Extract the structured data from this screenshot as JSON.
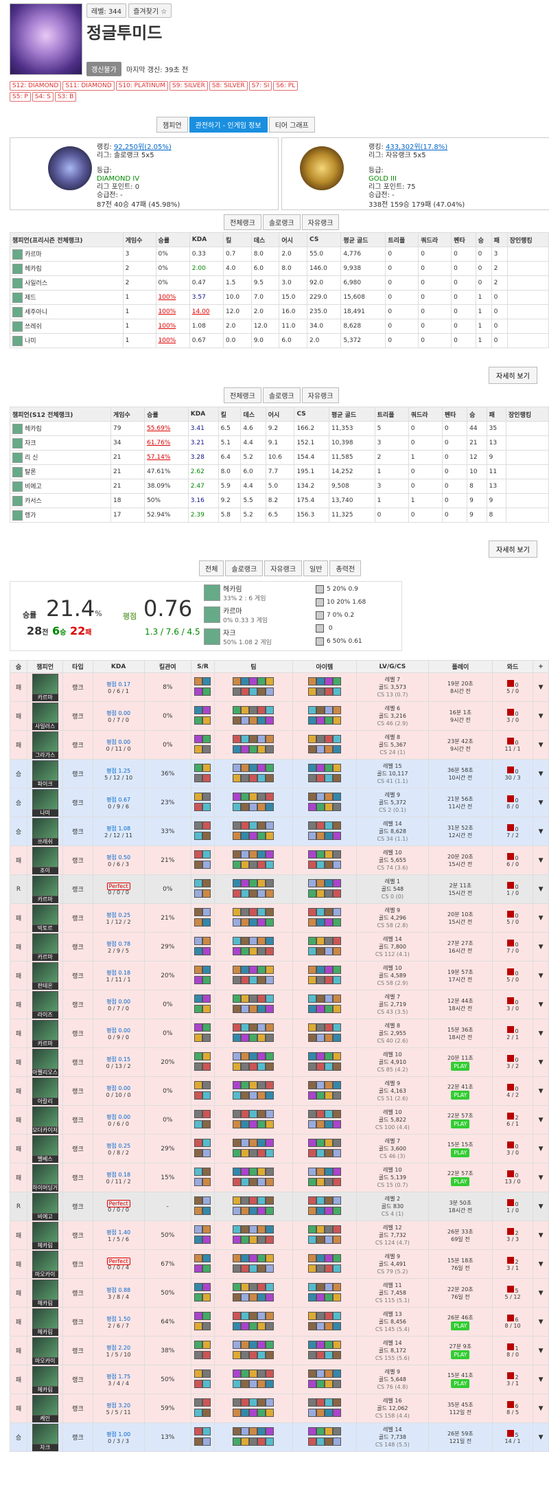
{
  "profile": {
    "level": "레벨: 344",
    "favorite": "즐겨찾기 ☆",
    "name": "정글투미드",
    "refresh": "갱신불가",
    "last_update": "마지막 갱신: 39초 전",
    "seasons": [
      "S12: DIAMOND",
      "S11: DIAMOND",
      "S10: PLATINUM",
      "S9: SILVER",
      "S8: SILVER",
      "S7: SI",
      "S6: PL",
      "S5: P",
      "S4: S",
      "S3: B"
    ]
  },
  "tabs": [
    "챔피언",
    "관전하기 - 인게임 정보",
    "티어 그래프"
  ],
  "solo": {
    "rank_label": "랭킹:",
    "rank_val": "92,250위",
    "rank_pct": "(2.05%)",
    "league": "리그: 솔로랭크 5x5",
    "tier_label": "등급:",
    "tier": "DIAMOND IV",
    "lp": "리그 포인트: 0",
    "promo": "승급전: -",
    "record": "87전 40승 47패 (45.98%)"
  },
  "flex": {
    "rank_label": "랭킹:",
    "rank_val": "433,302위",
    "rank_pct": "(17.8%)",
    "league": "리그: 자유랭크 5x5",
    "tier_label": "등급:",
    "tier": "GOLD III",
    "lp": "리그 포인트: 75",
    "promo": "승급전: -",
    "record": "338전 159승 179패 (47.04%)"
  },
  "queue_tabs": [
    "전체랭크",
    "솔로랭크",
    "자유랭크"
  ],
  "table1": {
    "headers": [
      "챔피언(프리시즌 전체랭크)",
      "게임수",
      "승률",
      "KDA",
      "킬",
      "데스",
      "어시",
      "CS",
      "평균 골드",
      "트리플",
      "쿼드라",
      "펜타",
      "승",
      "패",
      "장인랭킹"
    ],
    "rows": [
      [
        "카르마",
        "3",
        "0%",
        "0.33",
        "0.7",
        "8.0",
        "2.0",
        "55.0",
        "4,776",
        "0",
        "0",
        "0",
        "0",
        "3",
        ""
      ],
      [
        "헤카림",
        "2",
        "0%",
        "2.00",
        "4.0",
        "6.0",
        "8.0",
        "146.0",
        "9,938",
        "0",
        "0",
        "0",
        "0",
        "2",
        ""
      ],
      [
        "사일러스",
        "2",
        "0%",
        "0.47",
        "1.5",
        "9.5",
        "3.0",
        "92.0",
        "6,980",
        "0",
        "0",
        "0",
        "0",
        "2",
        ""
      ],
      [
        "제드",
        "1",
        "100%",
        "3.57",
        "10.0",
        "7.0",
        "15.0",
        "229.0",
        "15,608",
        "0",
        "0",
        "0",
        "1",
        "0",
        ""
      ],
      [
        "세주아니",
        "1",
        "100%",
        "14.00",
        "12.0",
        "2.0",
        "16.0",
        "235.0",
        "18,491",
        "0",
        "0",
        "0",
        "1",
        "0",
        ""
      ],
      [
        "쓰레쉬",
        "1",
        "100%",
        "1.08",
        "2.0",
        "12.0",
        "11.0",
        "34.0",
        "8,628",
        "0",
        "0",
        "0",
        "1",
        "0",
        ""
      ],
      [
        "나미",
        "1",
        "100%",
        "0.67",
        "0.0",
        "9.0",
        "6.0",
        "2.0",
        "5,372",
        "0",
        "0",
        "0",
        "1",
        "0",
        ""
      ]
    ]
  },
  "more": "자세히 보기",
  "table2": {
    "headers": [
      "챔피언(S12 전체랭크)",
      "게임수",
      "승률",
      "KDA",
      "킬",
      "데스",
      "어시",
      "CS",
      "평균 골드",
      "트리플",
      "쿼드라",
      "펜타",
      "승",
      "패",
      "장인랭킹"
    ],
    "rows": [
      [
        "헤카림",
        "79",
        "55.69%",
        "3.41",
        "6.5",
        "4.6",
        "9.2",
        "166.2",
        "11,353",
        "5",
        "0",
        "0",
        "44",
        "35",
        ""
      ],
      [
        "자크",
        "34",
        "61.76%",
        "3.21",
        "5.1",
        "4.4",
        "9.1",
        "152.1",
        "10,398",
        "3",
        "0",
        "0",
        "21",
        "13",
        ""
      ],
      [
        "리 신",
        "21",
        "57.14%",
        "3.28",
        "6.4",
        "5.2",
        "10.6",
        "154.4",
        "11,585",
        "2",
        "1",
        "0",
        "12",
        "9",
        ""
      ],
      [
        "탈론",
        "21",
        "47.61%",
        "2.62",
        "8.0",
        "6.0",
        "7.7",
        "195.1",
        "14,252",
        "1",
        "0",
        "0",
        "10",
        "11",
        ""
      ],
      [
        "비에고",
        "21",
        "38.09%",
        "2.47",
        "5.9",
        "4.4",
        "5.0",
        "134.2",
        "9,508",
        "3",
        "0",
        "0",
        "8",
        "13",
        ""
      ],
      [
        "카서스",
        "18",
        "50%",
        "3.16",
        "9.2",
        "5.5",
        "8.2",
        "175.4",
        "13,740",
        "1",
        "1",
        "0",
        "9",
        "9",
        ""
      ],
      [
        "렝가",
        "17",
        "52.94%",
        "2.39",
        "5.8",
        "5.2",
        "6.5",
        "156.3",
        "11,325",
        "0",
        "0",
        "0",
        "9",
        "8",
        ""
      ]
    ]
  },
  "filter_tabs": [
    "전체",
    "솔로랭크",
    "자유랭크",
    "일반",
    "총력전"
  ],
  "summary": {
    "wr_label": "승률",
    "wr": "21.4",
    "wr_unit": "%",
    "games": "28",
    "games_u": "전",
    "wins": "6",
    "wins_u": "승",
    "losses": "22",
    "losses_u": "패",
    "kda_label": "평점",
    "kda": "0.76",
    "kda_detail": "1.3 / 7.6 / 4.5",
    "top": [
      {
        "name": "헤카림",
        "line": "33%   2 : 6 게임"
      },
      {
        "name": "카르마",
        "line": "0%   0.33   3 게임"
      },
      {
        "name": "자크",
        "line": "50%   1.08   2 게임"
      }
    ],
    "positions": [
      {
        "a": "5",
        "b": "20%",
        "c": "0.9"
      },
      {
        "a": "10",
        "b": "20%",
        "c": "1.68"
      },
      {
        "a": "7",
        "b": "0%",
        "c": "0.2"
      },
      {
        "a": "",
        "b": "",
        "c": "0"
      },
      {
        "a": "6",
        "b": "50%",
        "c": "0.61"
      }
    ]
  },
  "match_headers": [
    "승",
    "챔피언",
    "타입",
    "KDA",
    "킬관여",
    "S/R",
    "팀",
    "아이템",
    "LV/G/CS",
    "플레이",
    "와드",
    "+"
  ],
  "matches": [
    {
      "r": "패",
      "c": "카르마",
      "t": "랭크",
      "k1": "평점 0.17",
      "k2": "0 / 6 / 1",
      "p": "8%",
      "lv": "레벨 7",
      "g": "골드 3,573",
      "cs": "CS 13 (0.7)",
      "pl1": "19분 20초",
      "pl2": "8시간 전",
      "w": "0",
      "w2": "5 / 0",
      "cls": "lose"
    },
    {
      "r": "패",
      "c": "사일러스",
      "t": "랭크",
      "k1": "평점 0.00",
      "k2": "0 / 7 / 0",
      "p": "0%",
      "lv": "레벨 6",
      "g": "골드 3,216",
      "cs": "CS 46 (2.9)",
      "pl1": "16분 1초",
      "pl2": "9시간 전",
      "w": "0",
      "w2": "3 / 0",
      "cls": "lose"
    },
    {
      "r": "패",
      "c": "그라가스",
      "t": "랭크",
      "k1": "평점 0.00",
      "k2": "0 / 11 / 0",
      "p": "0%",
      "lv": "레벨 8",
      "g": "골드 5,367",
      "cs": "CS 24 (1)",
      "pl1": "23분 42초",
      "pl2": "9시간 전",
      "w": "0",
      "w2": "11 / 1",
      "cls": "lose"
    },
    {
      "r": "승",
      "c": "파이크",
      "t": "랭크",
      "k1": "평점 1.25",
      "k2": "5 / 12 / 10",
      "p": "36%",
      "lv": "레벨 15",
      "g": "골드 10,117",
      "cs": "CS 41 (1.1)",
      "pl1": "36분 58초",
      "pl2": "10시간 전",
      "w": "0",
      "w2": "30 / 3",
      "cls": "win"
    },
    {
      "r": "승",
      "c": "나미",
      "t": "랭크",
      "k1": "평점 0.67",
      "k2": "0 / 9 / 6",
      "p": "23%",
      "lv": "레벨 9",
      "g": "골드 5,372",
      "cs": "CS 2 (0.1)",
      "pl1": "21분 56초",
      "pl2": "11시간 전",
      "w": "0",
      "w2": "8 / 0",
      "cls": "win"
    },
    {
      "r": "승",
      "c": "쓰레쉬",
      "t": "랭크",
      "k1": "평점 1.08",
      "k2": "2 / 12 / 11",
      "p": "33%",
      "lv": "레벨 14",
      "g": "골드 8,628",
      "cs": "CS 34 (1.1)",
      "pl1": "31분 52초",
      "pl2": "12시간 전",
      "w": "0",
      "w2": "7 / 2",
      "cls": "win"
    },
    {
      "r": "패",
      "c": "조이",
      "t": "랭크",
      "k1": "평점 0.50",
      "k2": "0 / 6 / 3",
      "p": "21%",
      "lv": "레벨 10",
      "g": "골드 5,655",
      "cs": "CS 74 (3.6)",
      "pl1": "20분 20초",
      "pl2": "15시간 전",
      "w": "0",
      "w2": "6 / 0",
      "cls": "lose"
    },
    {
      "r": "R",
      "c": "카르마",
      "t": "랭크",
      "k1": "Perfect",
      "k2": "0 / 0 / 0",
      "p": "0%",
      "lv": "레벨 1",
      "g": "골드 548",
      "cs": "CS 0 (0)",
      "pl1": "2분 11초",
      "pl2": "15시간 전",
      "w": "0",
      "w2": "1 / 0",
      "cls": "remake"
    },
    {
      "r": "패",
      "c": "빅토르",
      "t": "랭크",
      "k1": "평점 0.25",
      "k2": "1 / 12 / 2",
      "p": "21%",
      "lv": "레벨 9",
      "g": "골드 4,296",
      "cs": "CS 58 (2.8)",
      "pl1": "20분 10초",
      "pl2": "15시간 전",
      "w": "0",
      "w2": "5 / 0",
      "cls": "lose"
    },
    {
      "r": "패",
      "c": "카르마",
      "t": "랭크",
      "k1": "평점 0.78",
      "k2": "2 / 9 / 5",
      "p": "29%",
      "lv": "레벨 14",
      "g": "골드 7,800",
      "cs": "CS 112 (4.1)",
      "pl1": "27분 27초",
      "pl2": "16시간 전",
      "w": "0",
      "w2": "7 / 0",
      "cls": "lose"
    },
    {
      "r": "패",
      "c": "판테온",
      "t": "랭크",
      "k1": "평점 0.18",
      "k2": "1 / 11 / 1",
      "p": "20%",
      "lv": "레벨 10",
      "g": "골드 4,589",
      "cs": "CS 58 (2.9)",
      "pl1": "19분 57초",
      "pl2": "17시간 전",
      "w": "0",
      "w2": "5 / 0",
      "cls": "lose"
    },
    {
      "r": "패",
      "c": "라이즈",
      "t": "랭크",
      "k1": "평점 0.00",
      "k2": "0 / 7 / 0",
      "p": "0%",
      "lv": "레벨 7",
      "g": "골드 2,719",
      "cs": "CS 43 (3.5)",
      "pl1": "12분 44초",
      "pl2": "18시간 전",
      "w": "0",
      "w2": "3 / 0",
      "cls": "lose"
    },
    {
      "r": "패",
      "c": "카르마",
      "t": "랭크",
      "k1": "평점 0.00",
      "k2": "0 / 9 / 0",
      "p": "0%",
      "lv": "레벨 8",
      "g": "골드 2,955",
      "cs": "CS 40 (2.6)",
      "pl1": "15분 36초",
      "pl2": "18시간 전",
      "w": "0",
      "w2": "2 / 1",
      "cls": "lose"
    },
    {
      "r": "패",
      "c": "아펠리오스",
      "t": "랭크",
      "k1": "평점 0.15",
      "k2": "0 / 13 / 2",
      "p": "20%",
      "lv": "레벨 10",
      "g": "골드 4,910",
      "cs": "CS 85 (4.2)",
      "pl1": "20분 11초",
      "pl2": "PLAY",
      "w": "0",
      "w2": "3 / 2",
      "cls": "lose"
    },
    {
      "r": "패",
      "c": "아칼리",
      "t": "랭크",
      "k1": "평점 0.00",
      "k2": "0 / 10 / 0",
      "p": "0%",
      "lv": "레벨 9",
      "g": "골드 4,163",
      "cs": "CS 51 (2.6)",
      "pl1": "22분 41초",
      "pl2": "PLAY",
      "w": "0",
      "w2": "4 / 2",
      "cls": "lose"
    },
    {
      "r": "패",
      "c": "모더카이저",
      "t": "랭크",
      "k1": "평점 0.00",
      "k2": "0 / 6 / 0",
      "p": "0%",
      "lv": "레벨 10",
      "g": "골드 5,822",
      "cs": "CS 100 (4.4)",
      "pl1": "22분 57초",
      "pl2": "PLAY",
      "w": "2",
      "w2": "6 / 1",
      "cls": "lose"
    },
    {
      "r": "패",
      "c": "벨베스",
      "t": "랭크",
      "k1": "평점 0.25",
      "k2": "0 / 8 / 2",
      "p": "29%",
      "lv": "레벨 7",
      "g": "골드 3,600",
      "cs": "CS 46 (3)",
      "pl1": "15분 15초",
      "pl2": "PLAY",
      "w": "0",
      "w2": "3 / 0",
      "cls": "lose"
    },
    {
      "r": "패",
      "c": "하이머딩거",
      "t": "랭크",
      "k1": "평점 0.18",
      "k2": "0 / 11 / 2",
      "p": "15%",
      "lv": "레벨 10",
      "g": "골드 5,139",
      "cs": "CS 15 (0.7)",
      "pl1": "22분 57초",
      "pl2": "PLAY",
      "w": "0",
      "w2": "13 / 0",
      "cls": "lose"
    },
    {
      "r": "R",
      "c": "비에고",
      "t": "랭크",
      "k1": "Perfect",
      "k2": "0 / 0 / 0",
      "p": "-",
      "lv": "레벨 2",
      "g": "골드 830",
      "cs": "CS 4 (1)",
      "pl1": "3분 50초",
      "pl2": "18시간 전",
      "w": "0",
      "w2": "1 / 0",
      "cls": "remake"
    },
    {
      "r": "패",
      "c": "헤카림",
      "t": "랭크",
      "k1": "평점 1.40",
      "k2": "1 / 5 / 6",
      "p": "50%",
      "lv": "레벨 12",
      "g": "골드 7,732",
      "cs": "CS 124 (4.7)",
      "pl1": "26분 33초",
      "pl2": "69일 전",
      "w": "2",
      "w2": "3 / 3",
      "cls": "lose"
    },
    {
      "r": "패",
      "c": "마오카이",
      "t": "랭크",
      "k1": "Perfect",
      "k2": "0 / 0 / 4",
      "p": "67%",
      "lv": "레벨 9",
      "g": "골드 4,491",
      "cs": "CS 79 (5.2)",
      "pl1": "15분 18초",
      "pl2": "76일 전",
      "w": "2",
      "w2": "3 / 1",
      "cls": "lose"
    },
    {
      "r": "패",
      "c": "헤카림",
      "t": "랭크",
      "k1": "평점 0.88",
      "k2": "3 / 8 / 4",
      "p": "50%",
      "lv": "레벨 11",
      "g": "골드 7,458",
      "cs": "CS 115 (5.1)",
      "pl1": "22분 20초",
      "pl2": "76일 전",
      "w": "5",
      "w2": "5 / 12",
      "cls": "lose"
    },
    {
      "r": "패",
      "c": "헤카림",
      "t": "랭크",
      "k1": "평점 1.50",
      "k2": "2 / 6 / 7",
      "p": "64%",
      "lv": "레벨 13",
      "g": "골드 8,456",
      "cs": "CS 145 (5.4)",
      "pl1": "26분 46초",
      "pl2": "PLAY",
      "w": "6",
      "w2": "8 / 10",
      "cls": "lose"
    },
    {
      "r": "패",
      "c": "마오카이",
      "t": "랭크",
      "k1": "평점 2.20",
      "k2": "1 / 5 / 10",
      "p": "38%",
      "lv": "레벨 14",
      "g": "골드 8,172",
      "cs": "CS 155 (5.6)",
      "pl1": "27분 9초",
      "pl2": "PLAY",
      "w": "1",
      "w2": "8 / 0",
      "cls": "lose"
    },
    {
      "r": "패",
      "c": "헤카림",
      "t": "랭크",
      "k1": "평점 1.75",
      "k2": "3 / 4 / 4",
      "p": "50%",
      "lv": "레벨 9",
      "g": "골드 5,648",
      "cs": "CS 76 (4.8)",
      "pl1": "15분 41초",
      "pl2": "PLAY",
      "w": "2",
      "w2": "3 / 1",
      "cls": "lose"
    },
    {
      "r": "패",
      "c": "케인",
      "t": "랭크",
      "k1": "평점 3.20",
      "k2": "5 / 5 / 11",
      "p": "59%",
      "lv": "레벨 16",
      "g": "골드 12,062",
      "cs": "CS 158 (4.4)",
      "pl1": "35분 45초",
      "pl2": "112일 전",
      "w": "6",
      "w2": "8 / 5",
      "cls": "lose"
    },
    {
      "r": "승",
      "c": "자크",
      "t": "랭크",
      "k1": "평점 1.00",
      "k2": "0 / 3 / 3",
      "p": "13%",
      "lv": "레벨 14",
      "g": "골드 7,738",
      "cs": "CS 148 (5.5)",
      "pl1": "26분 59초",
      "pl2": "121일 전",
      "w": "5",
      "w2": "14 / 1",
      "cls": "win"
    }
  ]
}
